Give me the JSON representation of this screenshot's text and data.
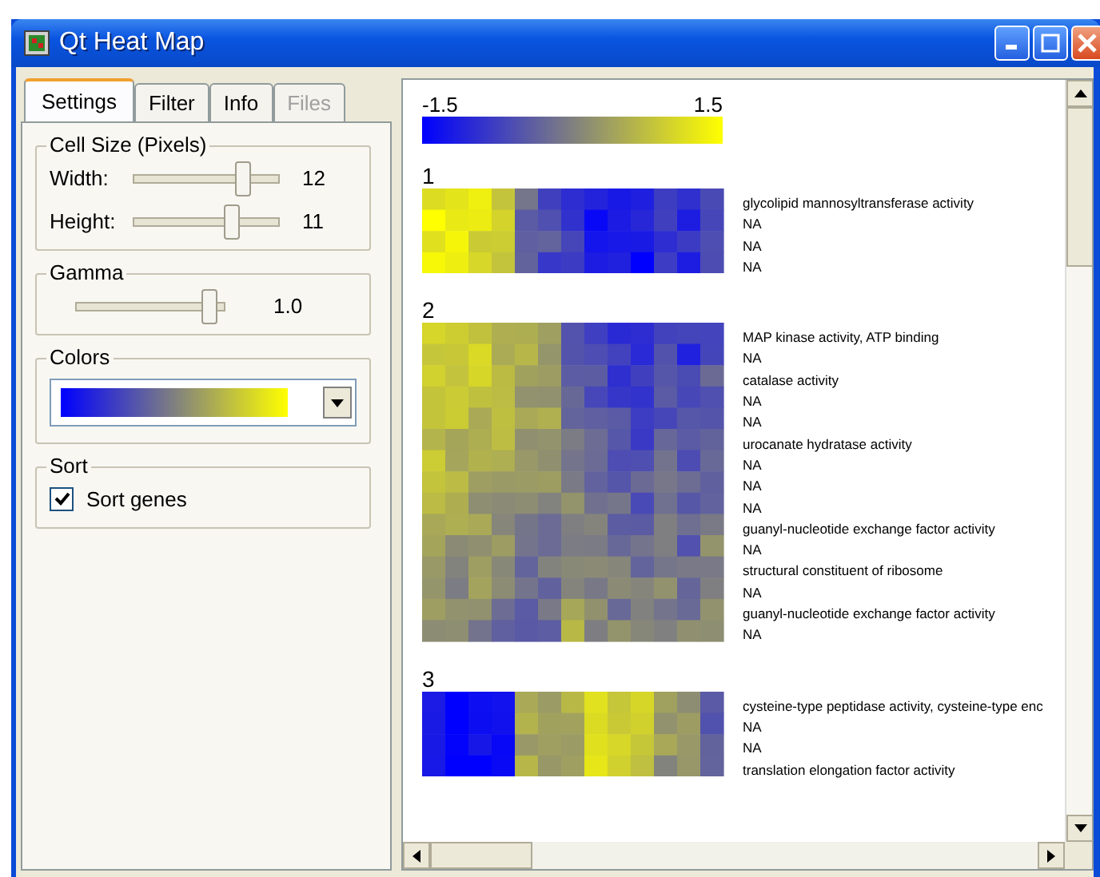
{
  "window": {
    "title": "Qt Heat Map"
  },
  "tabs": [
    {
      "label": "Settings",
      "selected": true,
      "disabled": false
    },
    {
      "label": "Filter",
      "selected": false,
      "disabled": false
    },
    {
      "label": "Info",
      "selected": false,
      "disabled": false
    },
    {
      "label": "Files",
      "selected": false,
      "disabled": true
    }
  ],
  "cell_size": {
    "title": "Cell Size (Pixels)",
    "sliders": [
      {
        "label": "Width:",
        "level": 0.75,
        "reading": "12"
      },
      {
        "label": "Height:",
        "level": 0.68,
        "reading": "11"
      }
    ]
  },
  "gamma": {
    "title": "Gamma",
    "level": 0.9,
    "reading": "1.0"
  },
  "colors": {
    "title": "Colors"
  },
  "sort": {
    "title": "Sort",
    "label": "Sort genes",
    "checked": true
  },
  "legend": {
    "min": "-1.5",
    "max": "1.5"
  },
  "clusters": [
    {
      "number": "1",
      "genes": [
        "glycolipid mannosyltransferase activity",
        "NA",
        "NA",
        "NA"
      ]
    },
    {
      "number": "2",
      "genes": [
        "MAP kinase activity, ATP binding",
        "NA",
        "catalase activity",
        "NA",
        "NA",
        "urocanate hydratase activity",
        "NA",
        "NA",
        "NA",
        "guanyl-nucleotide exchange factor activity",
        "NA",
        "structural constituent of ribosome",
        "NA",
        "guanyl-nucleotide exchange factor activity",
        "NA"
      ]
    },
    {
      "number": "3",
      "genes": [
        "cysteine-type peptidase activity, cysteine-type enc",
        "NA",
        "NA",
        "translation elongation factor activity"
      ]
    }
  ]
}
